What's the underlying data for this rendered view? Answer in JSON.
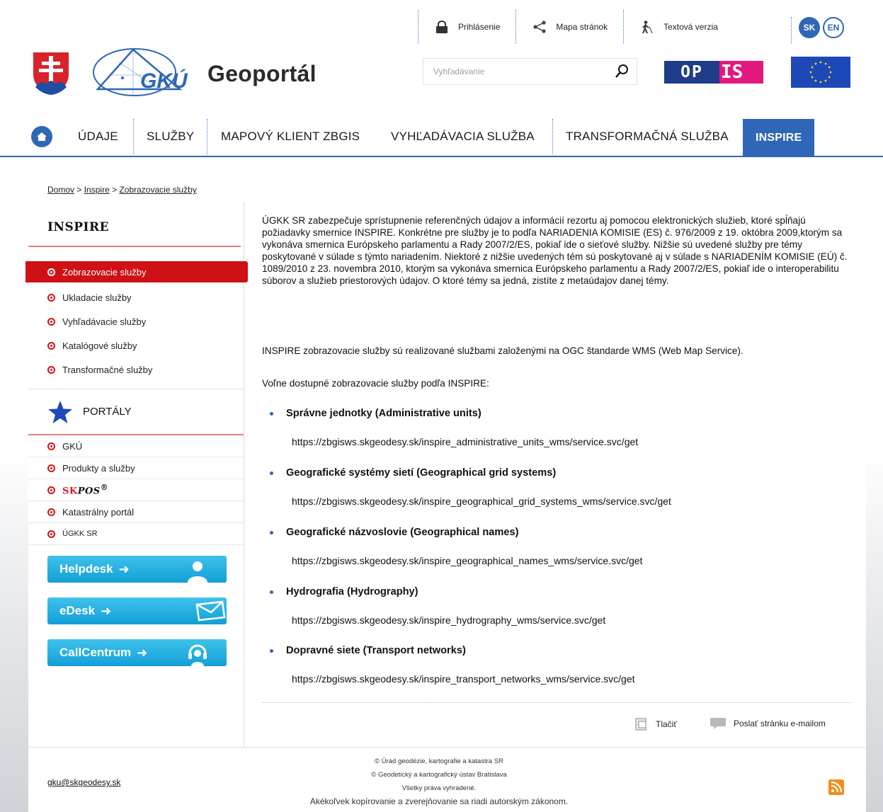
{
  "utility": {
    "login": "Prihlásenie",
    "sitemap": "Mapa stránok",
    "text_version": "Textová verzia",
    "lang_sk": "SK",
    "lang_en": "EN"
  },
  "logo": {
    "title": "Geoportál",
    "gku": "GKÚ",
    "opis_left": "OP",
    "opis_right": "IS"
  },
  "search": {
    "placeholder": "Vyhľadávanie"
  },
  "nav": {
    "items": [
      "ÚDAJE",
      "SLUŽBY",
      "MAPOVÝ KLIENT ZBGIS",
      "VYHĽADÁVACIA SLUŽBA",
      "TRANSFORMAČNÁ SLUŽBA",
      "INSPIRE"
    ],
    "active": "INSPIRE"
  },
  "breadcrumb": {
    "home": "Domov",
    "sep": ">",
    "level1": "Inspire",
    "current": "Zobrazovacie služby"
  },
  "sidebar": {
    "heading": "INSPIRE",
    "items": [
      "Zobrazovacie služby",
      "Ukladacie služby",
      "Vyhľadávacie služby",
      "Katalógové služby",
      "Transformačné služby"
    ],
    "portals_heading": "PORTÁLY",
    "portals": [
      "GKÚ",
      "Produkty a služby",
      "SKPOS®",
      "Katastrálny portál",
      "ÚGKK SR"
    ],
    "skpos_sk": "SK",
    "skpos_pos": "POS",
    "skpos_reg": "®",
    "cta": [
      "Helpdesk",
      "eDesk",
      "CallCentrum"
    ]
  },
  "article": {
    "intro": "ÚGKK SR zabezpečuje sprístupnenie referenčných údajov a informácií rezortu aj pomocou elektronických služieb, ktoré spĺňajú požiadavky smernice INSPIRE. Konkrétne pre služby je to podľa NARIADENIA KOMISIE (ES) č. 976/2009 z 19. októbra 2009,ktorým sa vykonáva smernica Európskeho parlamentu a Rady 2007/2/ES, pokiaľ ide o sieťové služby. Nižšie sú uvedené služby pre témy poskytované v súlade s týmto nariadením. Niektoré z nižšie uvedených tém sú poskytované aj v súlade s NARIADENÍM KOMISIE (EÚ) č. 1089/2010 z 23. novembra 2010, ktorým sa vykonáva smernica Európskeho parlamentu a Rady 2007/2/ES, pokiaľ ide o interoperabilitu súborov a služieb priestorových údajov. O ktoré témy sa jedná, zistíte z metaúdajov danej témy.",
    "p2": "INSPIRE zobrazovacie služby sú realizované službami založenými na OGC štandarde WMS (Web Map Service).",
    "p3": "Voľne dostupné zobrazovacie služby podľa INSPIRE:",
    "services": [
      {
        "title": "Správne jednotky (Administrative units)",
        "url": "https://zbgisws.skgeodesy.sk/inspire_administrative_units_wms/service.svc/get"
      },
      {
        "title": "Geografické systémy sietí (Geographical grid systems)",
        "url": "https://zbgisws.skgeodesy.sk/inspire_geographical_grid_systems_wms/service.svc/get"
      },
      {
        "title": "Geografické názvoslovie (Geographical names)",
        "url": "https://zbgisws.skgeodesy.sk/inspire_geographical_names_wms/service.svc/get"
      },
      {
        "title": "Hydrografia (Hydrography)",
        "url": "https://zbgisws.skgeodesy.sk/inspire_hydrography_wms/service.svc/get"
      },
      {
        "title": "Dopravné siete (Transport networks)",
        "url": "https://zbgisws.skgeodesy.sk/inspire_transport_networks_wms/service.svc/get"
      }
    ],
    "print": "Tlačiť",
    "email": "Poslať stránku e-mailom"
  },
  "footer": {
    "email": "gku@skgeodesy.sk",
    "line1": "© Úrad geodézie, kartografie a katastra SR",
    "line2": "© Geodetický a kartografický ústav Bratislava",
    "line3": "Všetky práva vyhradené.",
    "line4": "Akékoľvek kopírovanie a zverejňovanie sa riadi autorským zákonom."
  },
  "colors": {
    "brand_blue": "#2f66b7",
    "active_red": "#cf1015",
    "cta_cyan": "#1aa6dc",
    "opis_blue": "#1f3c8a",
    "opis_pink": "#e2187e"
  },
  "icons": [
    "lock-icon",
    "share-icon",
    "walking-person-icon",
    "search-icon",
    "home-icon",
    "star-icon",
    "user-icon",
    "envelope-icon",
    "headset-icon",
    "print-icon",
    "speech-bubble-icon",
    "rss-icon"
  ]
}
